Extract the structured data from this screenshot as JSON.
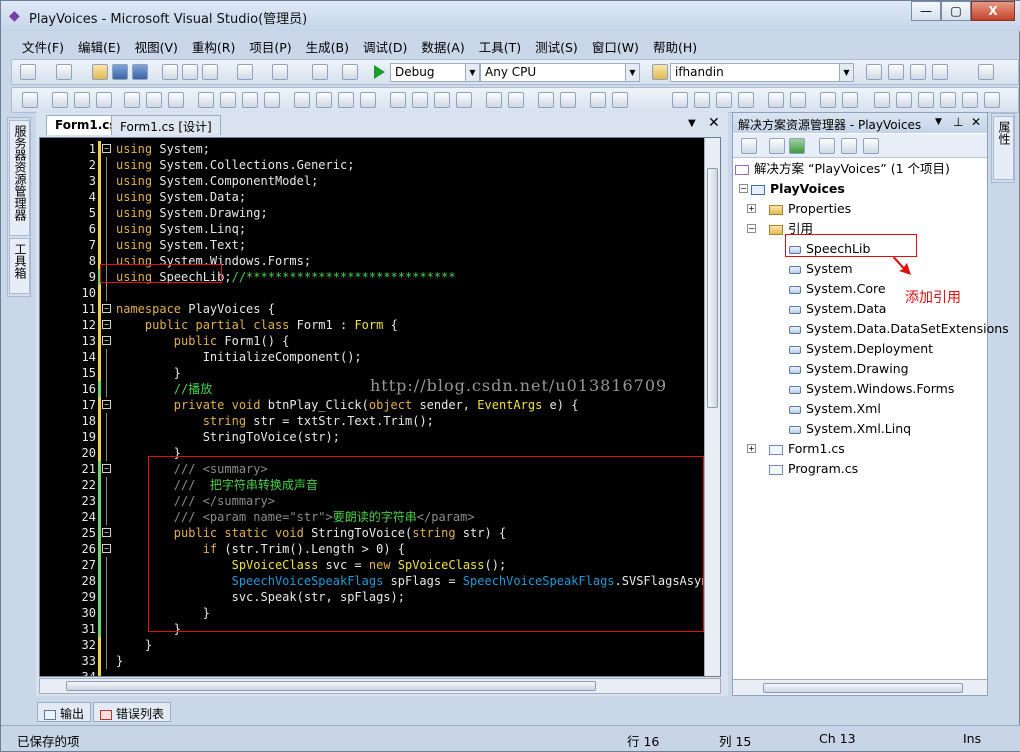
{
  "window": {
    "title": "PlayVoices - Microsoft Visual Studio(管理员)",
    "buttons": {
      "minimize": "—",
      "maximize": "▢",
      "close": "X"
    }
  },
  "menu": [
    "文件(F)",
    "编辑(E)",
    "视图(V)",
    "重构(R)",
    "项目(P)",
    "生成(B)",
    "调试(D)",
    "数据(A)",
    "工具(T)",
    "测试(S)",
    "窗口(W)",
    "帮助(H)"
  ],
  "toolbar": {
    "config": "Debug",
    "platform": "Any CPU",
    "find": "ifhandin"
  },
  "left_strip": {
    "server_explorer": "服务器资源管理器",
    "toolbox": "工具箱"
  },
  "right_strip": {
    "properties": "属性"
  },
  "editor": {
    "tabs": [
      {
        "label": "Form1.cs"
      },
      {
        "label": "Form1.cs [设计]"
      }
    ],
    "watermark": "http://blog.csdn.net/u013816709",
    "lines": [
      {
        "n": "1",
        "t": [
          [
            "kw",
            "using"
          ],
          [
            "pl",
            " System;"
          ]
        ]
      },
      {
        "n": "2",
        "t": [
          [
            "kw",
            "using"
          ],
          [
            "pl",
            " System.Collections.Generic;"
          ]
        ]
      },
      {
        "n": "3",
        "t": [
          [
            "kw",
            "using"
          ],
          [
            "pl",
            " System.ComponentModel;"
          ]
        ]
      },
      {
        "n": "4",
        "t": [
          [
            "kw",
            "using"
          ],
          [
            "pl",
            " System.Data;"
          ]
        ]
      },
      {
        "n": "5",
        "t": [
          [
            "kw",
            "using"
          ],
          [
            "pl",
            " System.Drawing;"
          ]
        ]
      },
      {
        "n": "6",
        "t": [
          [
            "kw",
            "using"
          ],
          [
            "pl",
            " System.Linq;"
          ]
        ]
      },
      {
        "n": "7",
        "t": [
          [
            "kw",
            "using"
          ],
          [
            "pl",
            " System.Text;"
          ]
        ]
      },
      {
        "n": "8",
        "t": [
          [
            "kw",
            "using"
          ],
          [
            "pl",
            " System.Windows.Forms;"
          ]
        ]
      },
      {
        "n": "9",
        "t": [
          [
            "kw",
            "using"
          ],
          [
            "pl",
            " SpeechLib;"
          ],
          [
            "cm",
            "//*****************************"
          ]
        ]
      },
      {
        "n": "10",
        "t": []
      },
      {
        "n": "11",
        "t": [
          [
            "kw",
            "namespace"
          ],
          [
            "pl",
            " PlayVoices {"
          ]
        ]
      },
      {
        "n": "12",
        "t": [
          [
            "pl",
            "    "
          ],
          [
            "kw",
            "public partial class"
          ],
          [
            "pl",
            " Form1 : "
          ],
          [
            "tyt",
            "Form"
          ],
          [
            "pl",
            " {"
          ]
        ]
      },
      {
        "n": "13",
        "t": [
          [
            "pl",
            "        "
          ],
          [
            "kw",
            "public"
          ],
          [
            "pl",
            " Form1() {"
          ]
        ]
      },
      {
        "n": "14",
        "t": [
          [
            "pl",
            "            InitializeComponent();"
          ]
        ]
      },
      {
        "n": "15",
        "t": [
          [
            "pl",
            "        }"
          ]
        ]
      },
      {
        "n": "16",
        "t": [
          [
            "pl",
            "        "
          ],
          [
            "cm",
            "//播放"
          ]
        ]
      },
      {
        "n": "17",
        "t": [
          [
            "pl",
            "        "
          ],
          [
            "kw",
            "private void"
          ],
          [
            "pl",
            " btnPlay_Click("
          ],
          [
            "kw",
            "object"
          ],
          [
            "pl",
            " sender, "
          ],
          [
            "tyt",
            "EventArgs"
          ],
          [
            "pl",
            " e) {"
          ]
        ]
      },
      {
        "n": "18",
        "t": [
          [
            "pl",
            "            "
          ],
          [
            "kw",
            "string"
          ],
          [
            "pl",
            " str = txtStr.Text.Trim();"
          ]
        ]
      },
      {
        "n": "19",
        "t": [
          [
            "pl",
            "            StringToVoice(str);"
          ]
        ]
      },
      {
        "n": "20",
        "t": [
          [
            "pl",
            "        }"
          ]
        ]
      },
      {
        "n": "21",
        "t": [
          [
            "pl",
            "        "
          ],
          [
            "xm",
            "/// <summary>"
          ]
        ]
      },
      {
        "n": "22",
        "t": [
          [
            "pl",
            "        "
          ],
          [
            "xm",
            "/// "
          ],
          [
            "cm",
            " 把字符串转换成声音"
          ]
        ]
      },
      {
        "n": "23",
        "t": [
          [
            "pl",
            "        "
          ],
          [
            "xm",
            "/// </summary>"
          ]
        ]
      },
      {
        "n": "24",
        "t": [
          [
            "pl",
            "        "
          ],
          [
            "xm",
            "/// <param name=\"str\">"
          ],
          [
            "cm",
            "要朗读的字符串"
          ],
          [
            "xm",
            "</param>"
          ]
        ]
      },
      {
        "n": "25",
        "t": [
          [
            "pl",
            "        "
          ],
          [
            "kw",
            "public static void"
          ],
          [
            "pl",
            " StringToVoice("
          ],
          [
            "kw",
            "string"
          ],
          [
            "pl",
            " str) {"
          ]
        ]
      },
      {
        "n": "26",
        "t": [
          [
            "pl",
            "            "
          ],
          [
            "kw",
            "if"
          ],
          [
            "pl",
            " (str.Trim().Length > 0) {"
          ]
        ]
      },
      {
        "n": "27",
        "t": [
          [
            "pl",
            "                "
          ],
          [
            "tyt",
            "SpVoiceClass"
          ],
          [
            "pl",
            " svc = "
          ],
          [
            "kw",
            "new"
          ],
          [
            "pl",
            " "
          ],
          [
            "tyt",
            "SpVoiceClass"
          ],
          [
            "pl",
            "();"
          ]
        ]
      },
      {
        "n": "28",
        "t": [
          [
            "pl",
            "                "
          ],
          [
            "ty",
            "SpeechVoiceSpeakFlags"
          ],
          [
            "pl",
            " spFlags = "
          ],
          [
            "ty",
            "SpeechVoiceSpeakFlags"
          ],
          [
            "pl",
            ".SVSFlagsAsync;"
          ]
        ]
      },
      {
        "n": "29",
        "t": [
          [
            "pl",
            "                svc.Speak(str, spFlags);"
          ]
        ]
      },
      {
        "n": "30",
        "t": [
          [
            "pl",
            "            }"
          ]
        ]
      },
      {
        "n": "31",
        "t": [
          [
            "pl",
            "        }"
          ]
        ]
      },
      {
        "n": "32",
        "t": [
          [
            "pl",
            "    }"
          ]
        ]
      },
      {
        "n": "33",
        "t": [
          [
            "pl",
            "}"
          ]
        ]
      },
      {
        "n": "34",
        "t": []
      }
    ]
  },
  "solution_explorer": {
    "title": "解决方案资源管理器 - PlayVoices",
    "solution_label": "解决方案 “PlayVoices” (1 个项目)",
    "project": "PlayVoices",
    "properties": "Properties",
    "references_folder": "引用",
    "references": [
      "SpeechLib",
      "System",
      "System.Core",
      "System.Data",
      "System.Data.DataSetExtensions",
      "System.Deployment",
      "System.Drawing",
      "System.Windows.Forms",
      "System.Xml",
      "System.Xml.Linq"
    ],
    "files": [
      "Form1.cs",
      "Program.cs"
    ]
  },
  "annotation": "添加引用",
  "bottom_tabs": [
    "输出",
    "错误列表"
  ],
  "status": {
    "message": "已保存的项",
    "line": "行 16",
    "col": "列 15",
    "ch": "Ch 13",
    "mode": "Ins"
  }
}
